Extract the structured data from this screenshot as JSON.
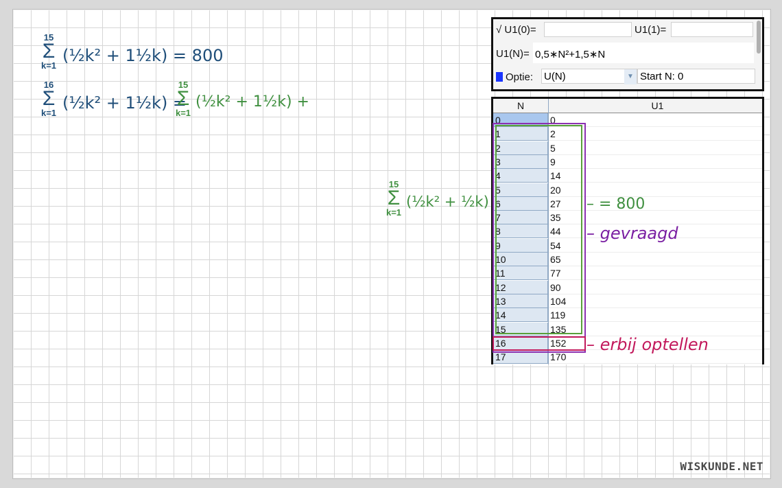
{
  "formulas": {
    "line1": {
      "sigma_top": "15",
      "sigma_bottom": "k=1",
      "expression": "(½k² + 1½k) = 800"
    },
    "line2": {
      "sigma_top": "16",
      "sigma_bottom": "k=1",
      "expression_left": "(½k² + 1½k) =",
      "rhs_sigma_top": "15",
      "rhs_sigma_bottom": "k=1",
      "rhs_expression": "(½k² + 1½k) +"
    },
    "side_note": {
      "sigma_top": "15",
      "sigma_bottom": "k=1",
      "expression": "(½k² + ½k) –"
    }
  },
  "calculator": {
    "checkmark": "√",
    "u1_0_label": "U1(0)=",
    "u1_0_value": "",
    "u1_1_label": "U1(1)=",
    "u1_1_value": "",
    "u1_n_label": "U1(N)=",
    "u1_n_value": "0,5∗N²+1,5∗N",
    "option_label": "Optie:",
    "option_value": "U(N)",
    "start_label": "Start N: 0",
    "swatch_color": "#1a35ff"
  },
  "table": {
    "headers": [
      "N",
      "U1"
    ],
    "rows": [
      [
        "0",
        "0"
      ],
      [
        "1",
        "2"
      ],
      [
        "2",
        "5"
      ],
      [
        "3",
        "9"
      ],
      [
        "4",
        "14"
      ],
      [
        "5",
        "20"
      ],
      [
        "6",
        "27"
      ],
      [
        "7",
        "35"
      ],
      [
        "8",
        "44"
      ],
      [
        "9",
        "54"
      ],
      [
        "10",
        "65"
      ],
      [
        "11",
        "77"
      ],
      [
        "12",
        "90"
      ],
      [
        "13",
        "104"
      ],
      [
        "14",
        "119"
      ],
      [
        "15",
        "135"
      ],
      [
        "16",
        "152"
      ],
      [
        "17",
        "170"
      ]
    ]
  },
  "annotations": {
    "green": "– = 800",
    "purple": "– gevraagd",
    "red": "– erbij optellen"
  },
  "colors": {
    "blue_ink": "#1f4e79",
    "green_ink": "#3f8f3f",
    "purple_ink": "#7a1fa2",
    "red_ink": "#c2185b"
  },
  "watermark": "WISKUNDE.NET"
}
